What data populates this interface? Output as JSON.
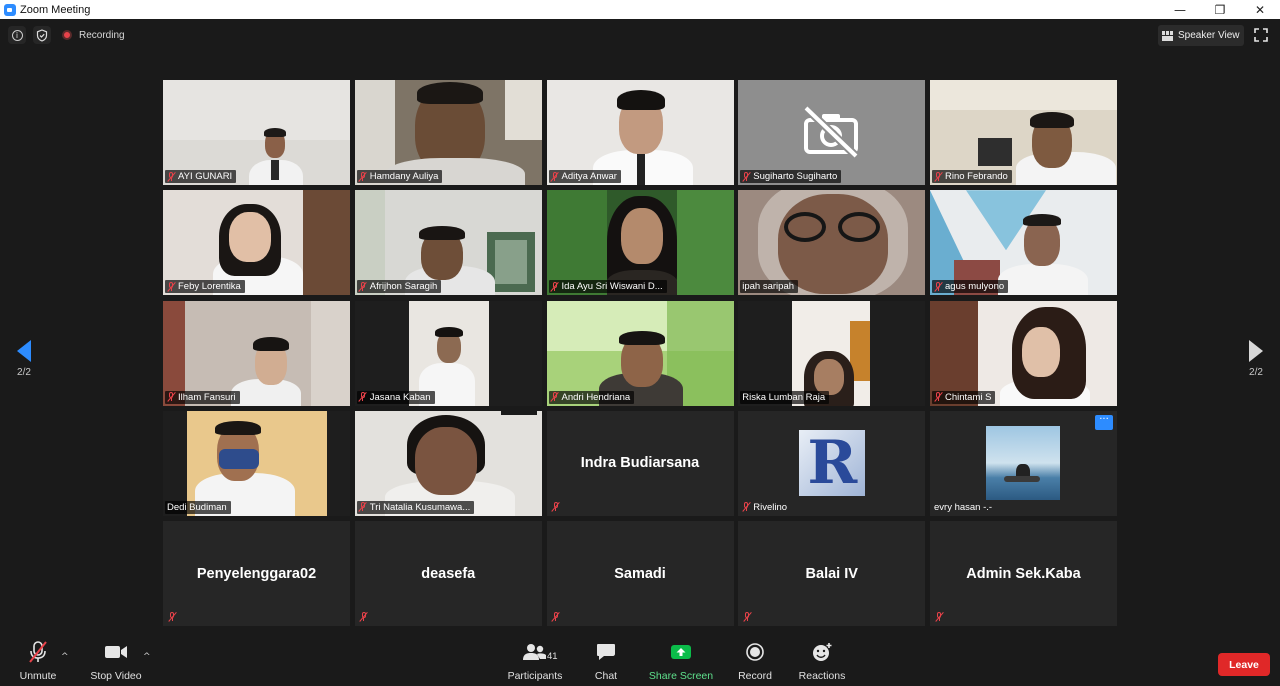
{
  "window": {
    "title": "Zoom Meeting",
    "minimize": "—",
    "restore": "❐",
    "close": "✕"
  },
  "topbar": {
    "recording_label": "Recording",
    "speaker_view_label": "Speaker View",
    "info_glyph": "i"
  },
  "paging": {
    "prev_page": "2/2",
    "next_page": "2/2"
  },
  "participants": [
    {
      "name": "AYI GUNARI",
      "muted": true,
      "video": true
    },
    {
      "name": "Hamdany Auliya",
      "muted": true,
      "video": true
    },
    {
      "name": "Aditya Anwar",
      "muted": true,
      "video": true
    },
    {
      "name": "Sugiharto Sugiharto",
      "muted": true,
      "video": false
    },
    {
      "name": "Rino Febrando",
      "muted": true,
      "video": true
    },
    {
      "name": "Feby Lorentika",
      "muted": true,
      "video": true
    },
    {
      "name": "Afrijhon Saragih",
      "muted": true,
      "video": true
    },
    {
      "name": "Ida Ayu Sri Wiswani D...",
      "muted": true,
      "video": true
    },
    {
      "name": "ipah saripah",
      "muted": false,
      "video": true
    },
    {
      "name": "agus mulyono",
      "muted": true,
      "video": true
    },
    {
      "name": "Ilham Fansuri",
      "muted": true,
      "video": true
    },
    {
      "name": "Jasana Kaban",
      "muted": true,
      "video": true
    },
    {
      "name": "Andri Hendriana",
      "muted": true,
      "video": true
    },
    {
      "name": "Riska Lumban Raja",
      "muted": false,
      "video": true
    },
    {
      "name": "Chintami S",
      "muted": true,
      "video": true
    },
    {
      "name": "Dedi Budiman",
      "muted": false,
      "video": true
    },
    {
      "name": "Tri Natalia Kusumawa...",
      "muted": true,
      "video": true
    },
    {
      "name": "Indra Budiarsana",
      "muted": true,
      "video": false
    },
    {
      "name": "Rivelino",
      "muted": true,
      "video": true
    },
    {
      "name": "evry hasan -.-",
      "muted": false,
      "video": true
    },
    {
      "name": "Penyelenggara02",
      "muted": true,
      "video": false
    },
    {
      "name": "deasefa",
      "muted": true,
      "video": false
    },
    {
      "name": "Samadi",
      "muted": true,
      "video": false
    },
    {
      "name": "Balai IV",
      "muted": true,
      "video": false
    },
    {
      "name": "Admin Sek.Kaba",
      "muted": true,
      "video": false
    }
  ],
  "rivelino_avatar_letter": "R",
  "more_button_glyph": "···",
  "toolbar": {
    "unmute": "Unmute",
    "stop_video": "Stop Video",
    "participants": "Participants",
    "participants_count": "41",
    "chat": "Chat",
    "share_screen": "Share Screen",
    "record": "Record",
    "reactions": "Reactions",
    "leave": "Leave",
    "caret": "^"
  },
  "colors": {
    "accent": "#2d8cff",
    "share_green": "#0bbc4a",
    "leave_red": "#e02828",
    "muted_red": "#e8424a"
  }
}
